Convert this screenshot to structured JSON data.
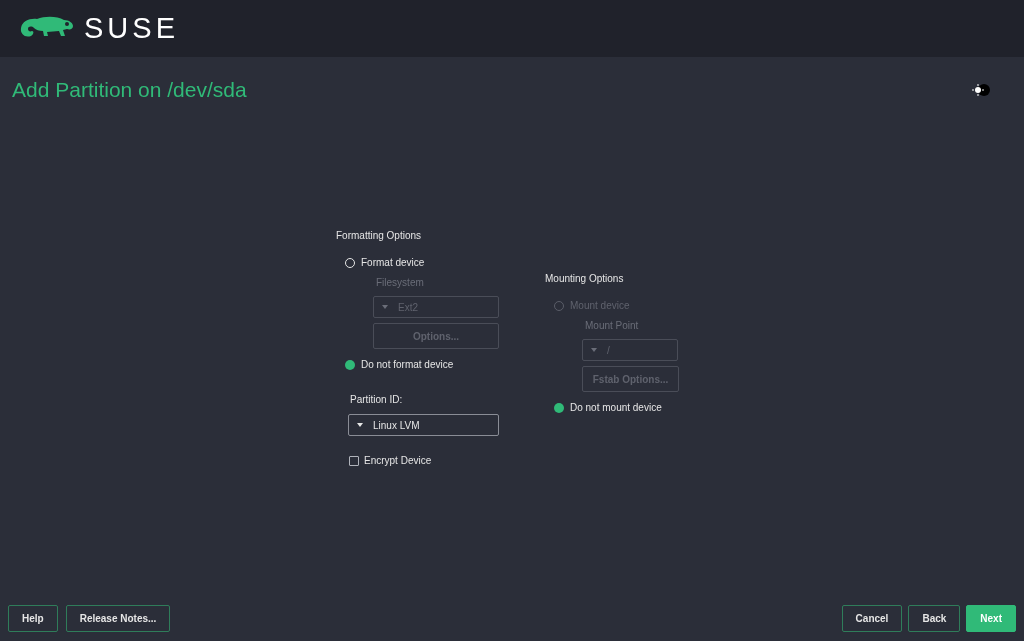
{
  "header": {
    "logo_text": "SUSE"
  },
  "title": "Add Partition on /dev/sda",
  "formatting": {
    "heading": "Formatting Options",
    "format_device": {
      "label": "Format device",
      "selected": false,
      "disabled": false
    },
    "filesystem": {
      "label": "Filesystem",
      "value": "Ext2",
      "disabled": true
    },
    "options_button": {
      "label": "Options...",
      "disabled": true
    },
    "do_not_format": {
      "label": "Do not format device",
      "selected": true,
      "disabled": false
    },
    "partition_id": {
      "label": "Partition ID:",
      "value": "Linux LVM"
    },
    "encrypt": {
      "label": "Encrypt Device",
      "checked": false
    }
  },
  "mounting": {
    "heading": "Mounting Options",
    "mount_device": {
      "label": "Mount device",
      "selected": false,
      "disabled": true
    },
    "mount_point": {
      "label": "Mount Point",
      "value": "/",
      "disabled": true
    },
    "fstab_button": {
      "label": "Fstab Options...",
      "disabled": true
    },
    "do_not_mount": {
      "label": "Do not mount device",
      "selected": true,
      "disabled": false
    }
  },
  "left_buttons": [
    {
      "label": "Help",
      "primary": false
    },
    {
      "label": "Release Notes...",
      "primary": false
    }
  ],
  "right_buttons": [
    {
      "label": "Cancel",
      "primary": false
    },
    {
      "label": "Back",
      "primary": false
    },
    {
      "label": "Next",
      "primary": true
    }
  ]
}
